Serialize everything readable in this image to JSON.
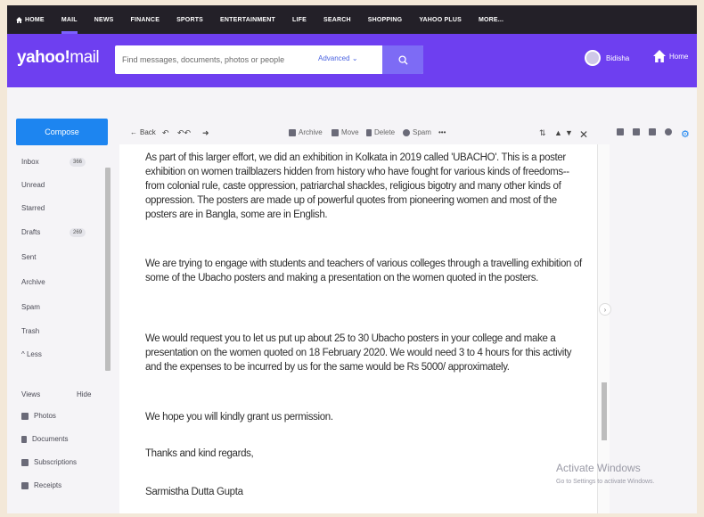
{
  "topnav": {
    "items": [
      {
        "label": "HOME",
        "icon": "home-icon"
      },
      {
        "label": "MAIL",
        "active": true
      },
      {
        "label": "NEWS"
      },
      {
        "label": "FINANCE"
      },
      {
        "label": "SPORTS"
      },
      {
        "label": "ENTERTAINMENT"
      },
      {
        "label": "LIFE"
      },
      {
        "label": "SEARCH"
      },
      {
        "label": "SHOPPING"
      },
      {
        "label": "YAHOO PLUS"
      },
      {
        "label": "MORE..."
      }
    ]
  },
  "header": {
    "logo_main": "yahoo!",
    "logo_sub": "mail",
    "search_placeholder": "Find messages, documents, photos or people",
    "advanced_label": "Advanced",
    "user_name": "Bidisha",
    "home_label": "Home"
  },
  "sidebar": {
    "compose_label": "Compose",
    "folders": [
      {
        "label": "Inbox",
        "count": "366"
      },
      {
        "label": "Unread"
      },
      {
        "label": "Starred"
      },
      {
        "label": "Drafts",
        "count": "269"
      },
      {
        "label": "Sent"
      },
      {
        "label": "Archive"
      },
      {
        "label": "Spam"
      },
      {
        "label": "Trash"
      },
      {
        "label": "^ Less"
      }
    ],
    "views_label": "Views",
    "hide_label": "Hide",
    "views": [
      {
        "label": "Photos",
        "icon": "photos-icon"
      },
      {
        "label": "Documents",
        "icon": "documents-icon"
      },
      {
        "label": "Subscriptions",
        "icon": "subscriptions-icon"
      },
      {
        "label": "Receipts",
        "icon": "receipts-icon"
      }
    ]
  },
  "toolbar": {
    "back_label": "Back",
    "archive_label": "Archive",
    "move_label": "Move",
    "delete_label": "Delete",
    "spam_label": "Spam",
    "more_label": "•••"
  },
  "message": {
    "paragraphs": [
      "As part of this larger effort, we did an exhibition in Kolkata in 2019 called 'UBACHO'. This is a poster exhibition on women trailblazers hidden from history who have fought for various kinds of freedoms--from colonial rule, caste oppression, patriarchal shackles, religious bigotry and many other kinds of oppression. The posters are made up of powerful quotes from pioneering women and most of the posters are in Bangla, some are in English.",
      "We are trying to engage with students and teachers of various colleges through a travelling exhibition of some of the Ubacho posters and making a presentation on the women quoted in the posters.",
      "We would request you to let us put up about 25 to 30 Ubacho posters in your college and make a presentation on the women quoted on 18 February 2020. We would need 3 to 4 hours for this activity and the expenses to be incurred by us for the same would be Rs 5000/ approximately.",
      "We hope you will kindly grant us permission.",
      "Thanks and kind regards,",
      "Sarmistha Dutta Gupta"
    ]
  },
  "watermark": {
    "title": "Activate Windows",
    "subtitle": "Go to Settings to activate Windows."
  },
  "colors": {
    "nav_bg": "#232028",
    "header_bg": "#6e3ff0",
    "compose_bg": "#1d85f0",
    "accent": "#7b61ff"
  }
}
